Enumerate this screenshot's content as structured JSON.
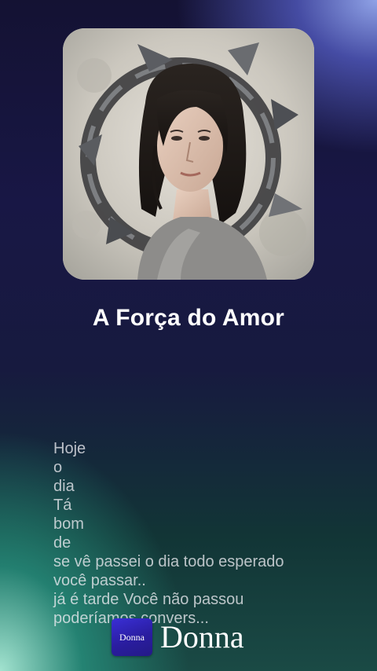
{
  "player": {
    "artwork_alt": "Woman portrait with shattered ring",
    "title": "A Força do Amor",
    "lyrics": [
      "Hoje",
      "o",
      "dia",
      "Tá",
      "bom",
      "de",
      "se vê passei o dia todo esperado",
      "você  passar..",
      "já é tarde Você não passou",
      "poderíamos convers..."
    ]
  },
  "brand": {
    "logo_text": "Donna",
    "name": "Donna"
  }
}
